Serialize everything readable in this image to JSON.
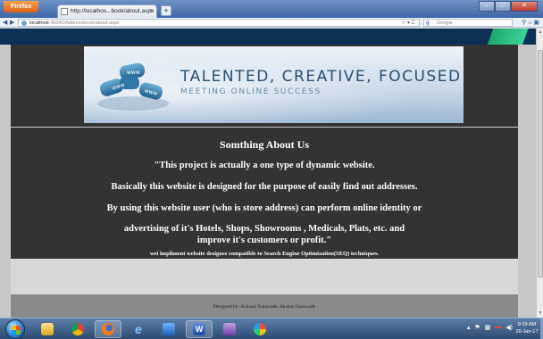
{
  "browser": {
    "app_button": "Firefox",
    "tab_title": "http://localhos...book/about.aspx",
    "url_host": "localhost",
    "url_path": ":49340/Addressbook/about.aspx",
    "search_engine": "Google"
  },
  "banner": {
    "title": "TALENTED, CREATIVE, FOCUSED",
    "subtitle": "MEETING ONLINE SUCCESS"
  },
  "about": {
    "heading": "Somthing About Us",
    "lines": [
      "\"This project is actually a one type of dynamic website.",
      "Basically this website is designed for the purpose of  easily find out addresses.",
      "By using this website user (who is store address) can perform online identity or",
      "advertising  of  it's  Hotels, Shops, Showrooms , Medicals, Plats, etc.  and",
      "improve it's customers or profit.\""
    ],
    "note": "wei impliment website designes compatible to Search Engine Optimization(SEQ) techniques."
  },
  "footer": {
    "credits": "Designed by: Avinash Nalawade, Akshay Nalawade"
  },
  "taskbar": {
    "time": "9:19 AM",
    "date": "20-Jan-17"
  },
  "colors": {
    "header_navy": "#0c3054",
    "header_green": "#1ea86b",
    "content_bg": "#333333",
    "footer_bg": "#8a8a8a",
    "banner_text": "#2a4f72"
  }
}
